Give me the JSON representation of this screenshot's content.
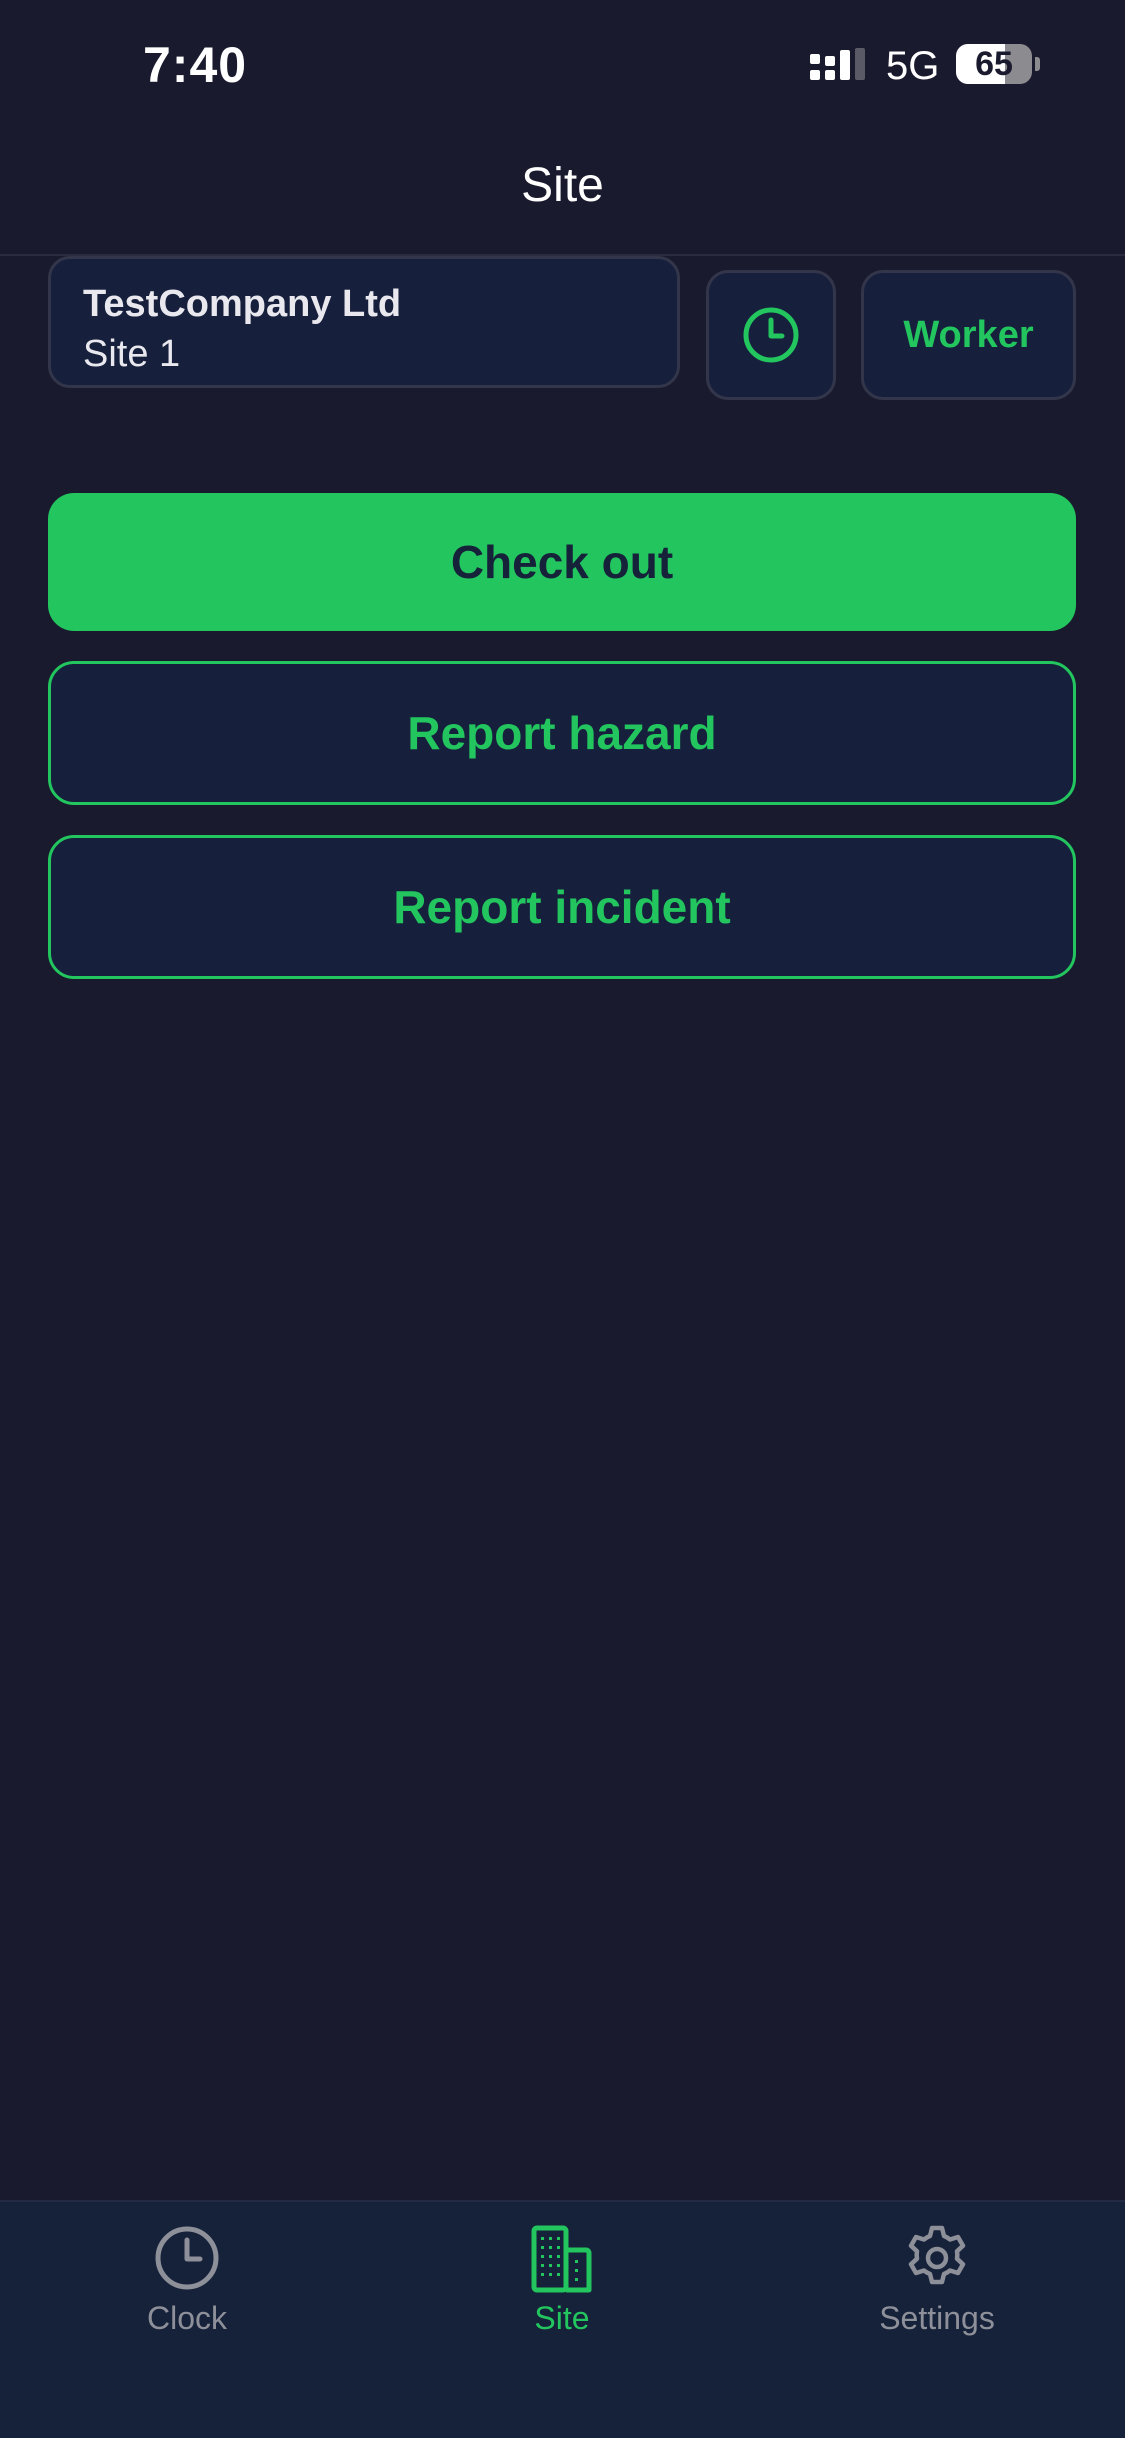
{
  "status_bar": {
    "time": "7:40",
    "network": "5G",
    "battery_level": "65"
  },
  "header": {
    "title": "Site"
  },
  "site_card": {
    "company": "TestCompany Ltd",
    "site": "Site 1"
  },
  "role_button": {
    "label": "Worker"
  },
  "actions": {
    "check_out": "Check out",
    "report_hazard": "Report hazard",
    "report_incident": "Report incident"
  },
  "tab_bar": {
    "tabs": [
      {
        "label": "Clock",
        "icon": "clock-icon",
        "active": false
      },
      {
        "label": "Site",
        "icon": "building-icon",
        "active": true
      },
      {
        "label": "Settings",
        "icon": "gear-icon",
        "active": false
      }
    ]
  },
  "colors": {
    "background": "#1a1a2e",
    "surface": "#161f3c",
    "accent": "#22c55e",
    "muted": "#8d9099"
  }
}
